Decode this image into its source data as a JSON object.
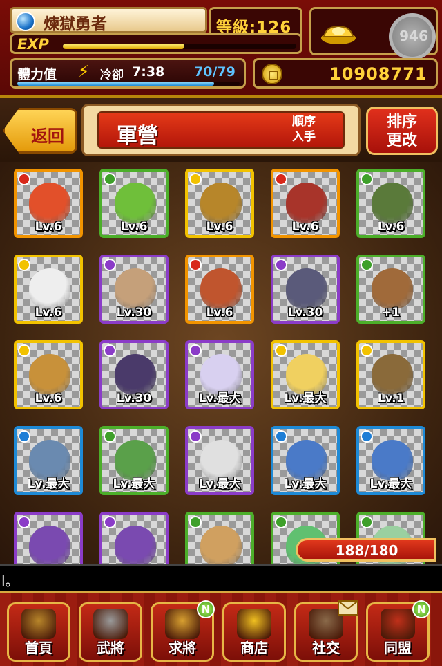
{
  "status": {
    "player_name": "煉獄勇者",
    "level_text": "等級:126",
    "exp_label": "EXP",
    "exp_fraction": 0.52,
    "gold_value": "946",
    "stamina_label": "體力值",
    "cooldown_label": "冷卻",
    "cooldown_time": "7:38",
    "stamina_value": "70/79",
    "stamina_fraction": 0.886,
    "coins": "10908771"
  },
  "header": {
    "back_label": "返回",
    "title": "軍營",
    "sort_order_line1": "順序",
    "sort_order_line2": "入手",
    "sort_button_line1": "排序",
    "sort_button_line2": "更改"
  },
  "cards": [
    {
      "level": "Lv.6",
      "element": "fire-icon",
      "border": "#f29400",
      "art": "#e2502a"
    },
    {
      "level": "Lv.6",
      "element": "wood-icon",
      "border": "#4caf2a",
      "art": "#6fbf3a"
    },
    {
      "level": "Lv.6",
      "element": "light-icon",
      "border": "#f2c200",
      "art": "#b7862a"
    },
    {
      "level": "Lv.6",
      "element": "fire-icon",
      "border": "#f29400",
      "art": "#a8342a"
    },
    {
      "level": "Lv.6",
      "element": "wood-icon",
      "border": "#4caf2a",
      "art": "#5a7a3a"
    },
    {
      "level": "Lv.6",
      "element": "light-icon",
      "border": "#f2c200",
      "art": "#eeeeee"
    },
    {
      "level": "Lv.30",
      "element": "dark-icon",
      "border": "#8b3cc8",
      "art": "#c5a07a"
    },
    {
      "level": "Lv.6",
      "element": "fire-icon",
      "border": "#f29400",
      "art": "#c0552e"
    },
    {
      "level": "Lv.30",
      "element": "dark-icon",
      "border": "#8b3cc8",
      "art": "#5a5a7a"
    },
    {
      "level": "+1",
      "element": "wood-icon",
      "border": "#4caf2a",
      "art": "#a06a3a"
    },
    {
      "level": "Lv.6",
      "element": "light-icon",
      "border": "#f2c200",
      "art": "#c8913a"
    },
    {
      "level": "Lv.30",
      "element": "dark-icon",
      "border": "#8b3cc8",
      "art": "#4a3a6a"
    },
    {
      "level": "Lv.最大",
      "element": "dark-icon",
      "border": "#8b3cc8",
      "art": "#d8d0f0"
    },
    {
      "level": "Lv.最大",
      "element": "light-icon",
      "border": "#f2c200",
      "art": "#f0d060"
    },
    {
      "level": "Lv.1",
      "element": "light-icon",
      "border": "#f2c200",
      "art": "#8a6a3a"
    },
    {
      "level": "Lv.最大",
      "element": "water-icon",
      "border": "#1e8ad6",
      "art": "#6a8ab0"
    },
    {
      "level": "Lv.最大",
      "element": "wood-icon",
      "border": "#4caf2a",
      "art": "#5aa04a"
    },
    {
      "level": "Lv.最大",
      "element": "dark-icon",
      "border": "#8b3cc8",
      "art": "#e0e0e0"
    },
    {
      "level": "Lv.最大",
      "element": "water-icon",
      "border": "#1e8ad6",
      "art": "#4a7ac8"
    },
    {
      "level": "Lv.最大",
      "element": "water-icon",
      "border": "#1e8ad6",
      "art": "#4a7ac8"
    },
    {
      "level": "",
      "element": "dark-icon",
      "border": "#8b3cc8",
      "art": "#7a4ab0"
    },
    {
      "level": "",
      "element": "dark-icon",
      "border": "#8b3cc8",
      "art": "#7a4ab0"
    },
    {
      "level": "",
      "element": "wood-icon",
      "border": "#4caf2a",
      "art": "#d0a060"
    },
    {
      "level": "",
      "element": "wood-icon",
      "border": "#4caf2a",
      "art": "#60c070"
    },
    {
      "level": "",
      "element": "wood-icon",
      "border": "#4caf2a",
      "art": "#9ad0a0"
    }
  ],
  "element_colors": {
    "fire-icon": "#d8281a",
    "wood-icon": "#3ea02a",
    "light-icon": "#f2c200",
    "dark-icon": "#8b3cc8",
    "water-icon": "#1e7ed6"
  },
  "capacity": "188/180",
  "message": "l。",
  "nav": [
    {
      "label": "首頁",
      "icon": "castle-icon",
      "badge": ""
    },
    {
      "label": "武將",
      "icon": "helmet-icon",
      "badge": ""
    },
    {
      "label": "求將",
      "icon": "recruit-icon",
      "badge": "N"
    },
    {
      "label": "商店",
      "icon": "gold-ingot-icon",
      "badge": ""
    },
    {
      "label": "社交",
      "icon": "handshake-icon",
      "badge": "mail"
    },
    {
      "label": "同盟",
      "icon": "alliance-icon",
      "badge": "N"
    }
  ]
}
